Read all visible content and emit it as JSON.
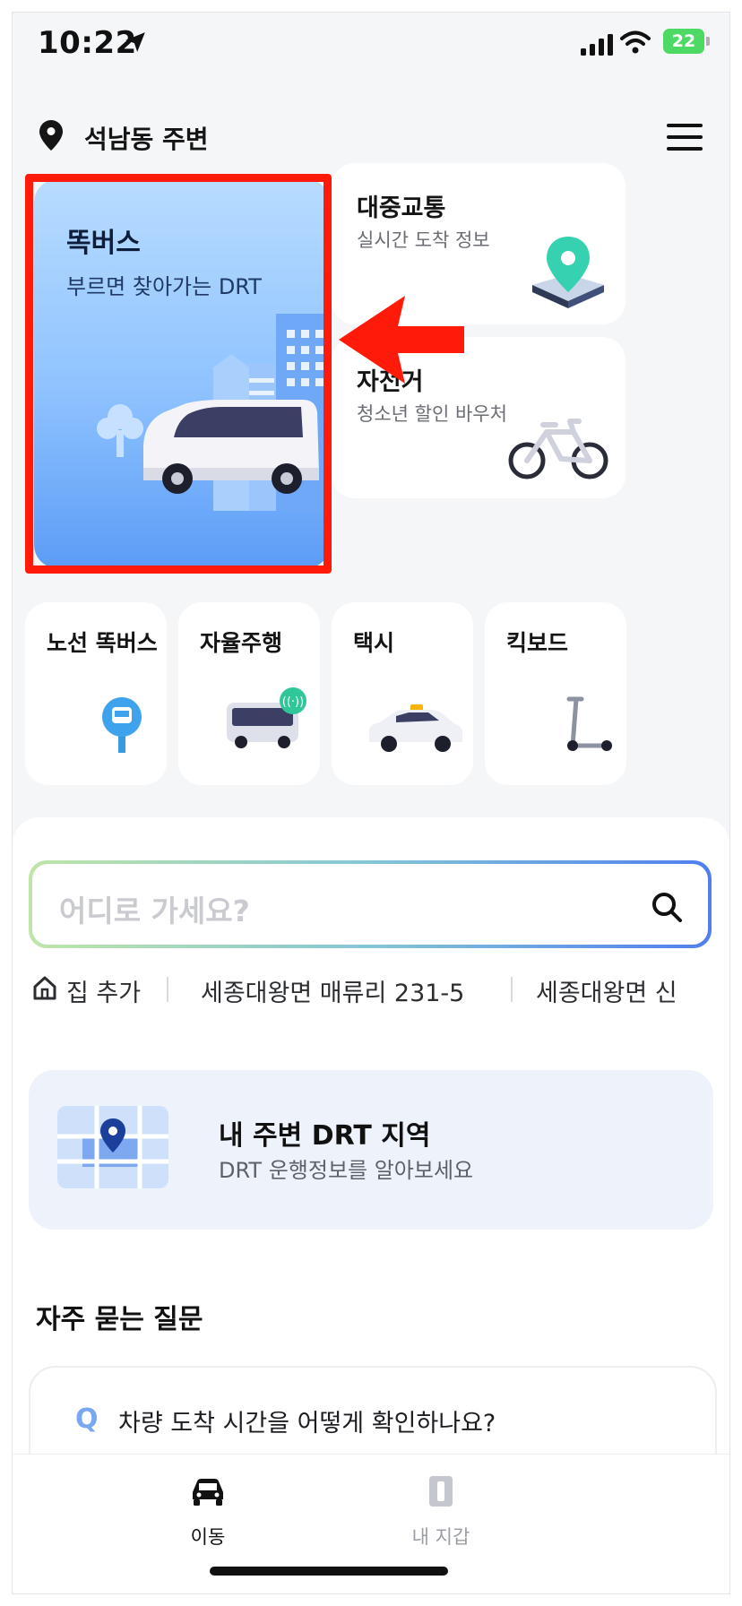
{
  "status_bar": {
    "time": "10:22",
    "battery": "22"
  },
  "header": {
    "location": "석남동 주변"
  },
  "main_card": {
    "title": "똑버스",
    "subtitle": "부르면 찾아가는 DRT"
  },
  "side_cards": [
    {
      "title": "대중교통",
      "subtitle": "실시간 도착 정보"
    },
    {
      "title": "자전거",
      "subtitle": "청소년 할인 바우처"
    }
  ],
  "small_cards": [
    {
      "title": "노선 똑버스"
    },
    {
      "title": "자율주행"
    },
    {
      "title": "택시"
    },
    {
      "title": "킥보드"
    }
  ],
  "search": {
    "placeholder": "어디로 가세요?"
  },
  "recent": {
    "home": "집 추가",
    "item1": "세종대왕면 매류리 231-5",
    "item2": "세종대왕면 신"
  },
  "drt_banner": {
    "title": "내 주변 DRT 지역",
    "subtitle": "DRT 운행정보를 알아보세요"
  },
  "faq": {
    "title": "자주 묻는 질문",
    "q_mark": "Q",
    "question": "차량 도착 시간을 어떻게 확인하나요?"
  },
  "tabs": [
    {
      "label": "이동"
    },
    {
      "label": "내 지갑"
    }
  ],
  "colors": {
    "accent": "#4f7ff0",
    "annotation": "#ff1a0a",
    "battery": "#4cd964"
  }
}
